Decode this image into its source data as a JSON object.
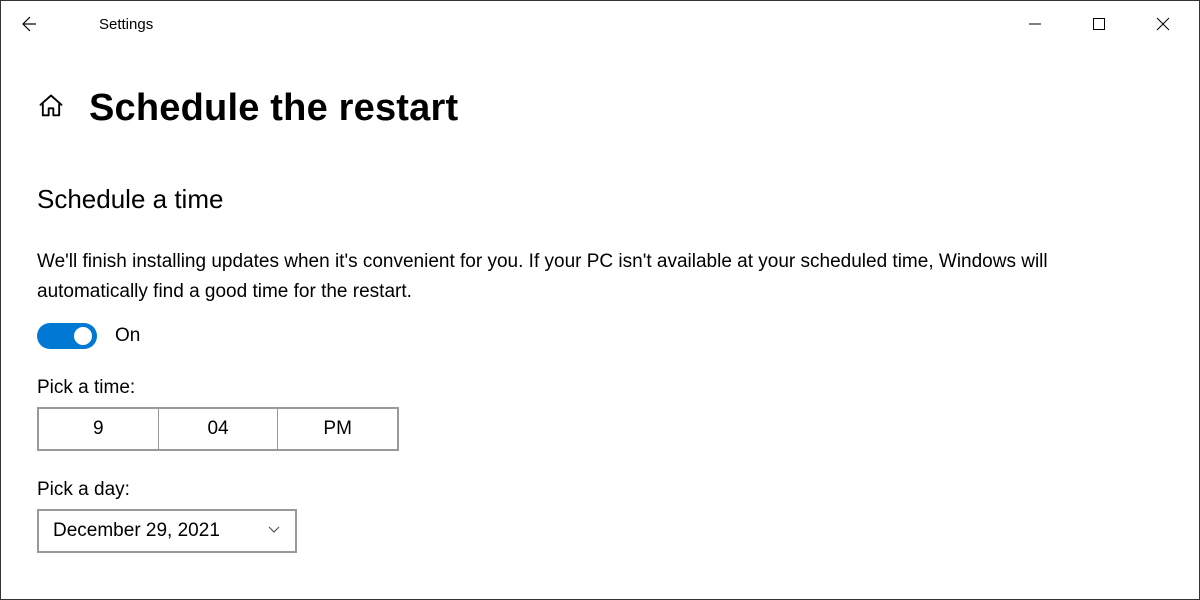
{
  "titlebar": {
    "title": "Settings"
  },
  "page": {
    "title": "Schedule the restart"
  },
  "section": {
    "title": "Schedule a time",
    "description": "We'll finish installing updates when it's convenient for you. If your PC isn't available at your scheduled time, Windows will automatically find a good time for the restart."
  },
  "toggle": {
    "state": "On"
  },
  "time": {
    "label": "Pick a time:",
    "hour": "9",
    "minute": "04",
    "period": "PM"
  },
  "day": {
    "label": "Pick a day:",
    "value": "December 29, 2021"
  }
}
